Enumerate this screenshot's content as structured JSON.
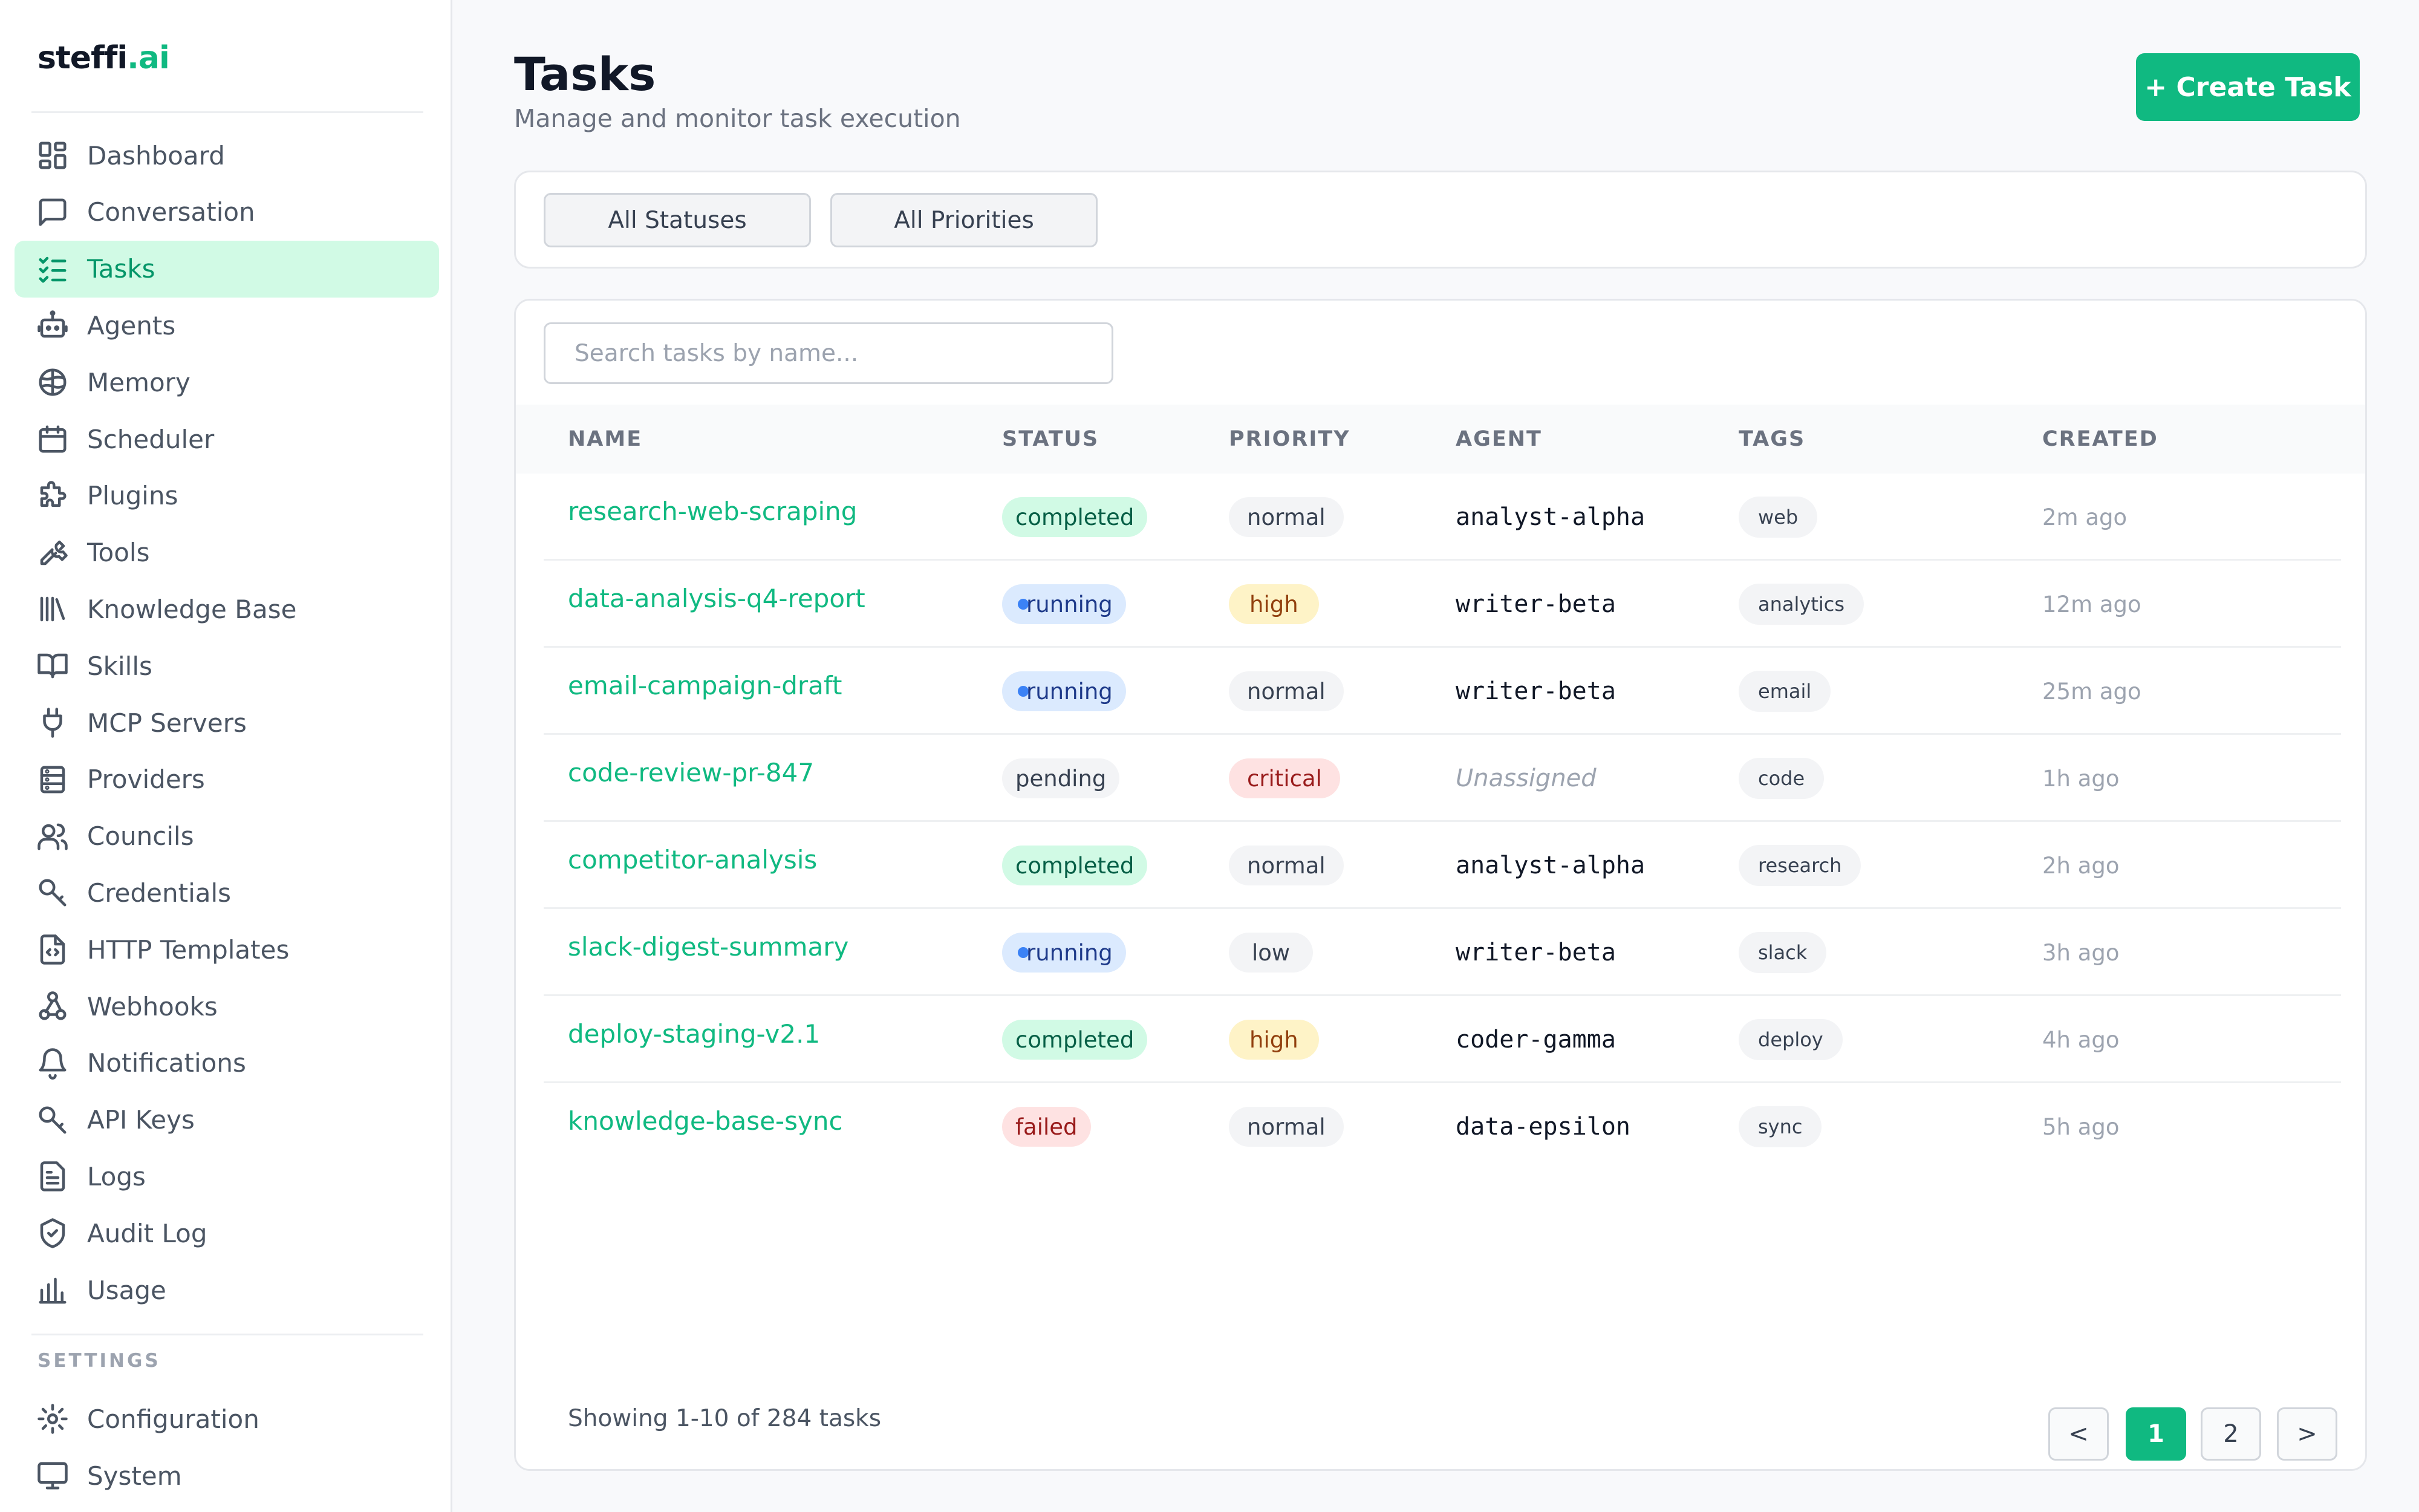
{
  "brand": {
    "name": "steffi",
    "dot": ".",
    "suffix": "ai"
  },
  "sidebar": {
    "items": [
      {
        "label": "Dashboard",
        "icon": "dashboard-icon"
      },
      {
        "label": "Conversation",
        "icon": "chat-icon"
      },
      {
        "label": "Tasks",
        "icon": "tasks-icon",
        "active": true
      },
      {
        "label": "Agents",
        "icon": "robot-icon"
      },
      {
        "label": "Memory",
        "icon": "brain-icon"
      },
      {
        "label": "Scheduler",
        "icon": "calendar-icon"
      },
      {
        "label": "Plugins",
        "icon": "puzzle-icon"
      },
      {
        "label": "Tools",
        "icon": "wrench-icon"
      },
      {
        "label": "Knowledge Base",
        "icon": "library-icon"
      },
      {
        "label": "Skills",
        "icon": "book-icon"
      },
      {
        "label": "MCP Servers",
        "icon": "plug-icon"
      },
      {
        "label": "Providers",
        "icon": "server-icon"
      },
      {
        "label": "Councils",
        "icon": "users-icon"
      },
      {
        "label": "Credentials",
        "icon": "key-icon"
      },
      {
        "label": "HTTP Templates",
        "icon": "file-code-icon"
      },
      {
        "label": "Webhooks",
        "icon": "webhook-icon"
      },
      {
        "label": "Notifications",
        "icon": "bell-icon"
      },
      {
        "label": "API Keys",
        "icon": "key-icon"
      },
      {
        "label": "Logs",
        "icon": "logs-icon"
      },
      {
        "label": "Audit Log",
        "icon": "shield-check-icon"
      },
      {
        "label": "Usage",
        "icon": "bar-chart-icon"
      }
    ],
    "settings_label": "SETTINGS",
    "settings_items": [
      {
        "label": "Configuration",
        "icon": "gear-icon"
      },
      {
        "label": "System",
        "icon": "monitor-icon"
      }
    ]
  },
  "header": {
    "title": "Tasks",
    "subtitle": "Manage and monitor task execution",
    "create_label": "+ Create Task"
  },
  "filters": {
    "status_label": "All Statuses",
    "priority_label": "All Priorities"
  },
  "search": {
    "placeholder": "Search tasks by name..."
  },
  "table": {
    "columns": [
      "NAME",
      "STATUS",
      "PRIORITY",
      "AGENT",
      "TAGS",
      "CREATED"
    ],
    "rows": [
      {
        "name": "research-web-scraping",
        "status": "completed",
        "priority": "normal",
        "agent": "analyst-alpha",
        "tag": "web",
        "created": "2m ago"
      },
      {
        "name": "data-analysis-q4-report",
        "status": "running",
        "priority": "high",
        "agent": "writer-beta",
        "tag": "analytics",
        "created": "12m ago"
      },
      {
        "name": "email-campaign-draft",
        "status": "running",
        "priority": "normal",
        "agent": "writer-beta",
        "tag": "email",
        "created": "25m ago"
      },
      {
        "name": "code-review-pr-847",
        "status": "pending",
        "priority": "critical",
        "agent": "Unassigned",
        "tag": "code",
        "created": "1h ago"
      },
      {
        "name": "competitor-analysis",
        "status": "completed",
        "priority": "normal",
        "agent": "analyst-alpha",
        "tag": "research",
        "created": "2h ago"
      },
      {
        "name": "slack-digest-summary",
        "status": "running",
        "priority": "low",
        "agent": "writer-beta",
        "tag": "slack",
        "created": "3h ago"
      },
      {
        "name": "deploy-staging-v2.1",
        "status": "completed",
        "priority": "high",
        "agent": "coder-gamma",
        "tag": "deploy",
        "created": "4h ago"
      },
      {
        "name": "knowledge-base-sync",
        "status": "failed",
        "priority": "normal",
        "agent": "data-epsilon",
        "tag": "sync",
        "created": "5h ago"
      }
    ]
  },
  "pagination": {
    "summary": "Showing 1-10 of 284 tasks",
    "prev": "<",
    "pages": [
      "1",
      "2"
    ],
    "current": "1",
    "next": ">"
  },
  "colors": {
    "accent": "#10b981",
    "accent_light": "#d1fae5",
    "running": "#dbeafe",
    "failed": "#fee2e2",
    "high": "#fef3c7"
  }
}
